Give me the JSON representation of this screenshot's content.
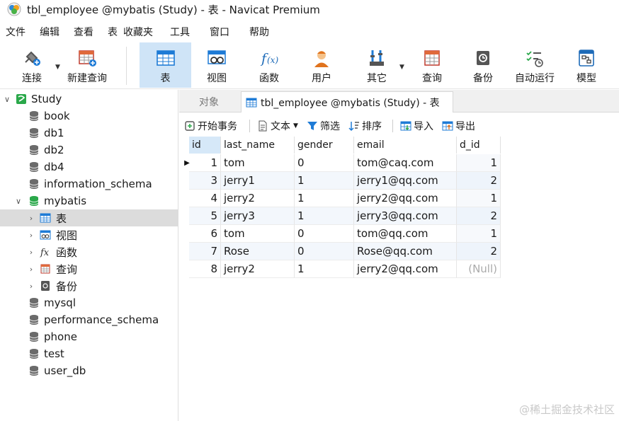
{
  "window": {
    "title": "tbl_employee @mybatis (Study) - 表 - Navicat Premium"
  },
  "menu": [
    "文件",
    "编辑",
    "查看",
    "表",
    "收藏夹",
    "工具",
    "窗口",
    "帮助"
  ],
  "toolbar": {
    "connect": "连接",
    "new_query": "新建查询",
    "table": "表",
    "view": "视图",
    "function": "函数",
    "user": "用户",
    "other": "其它",
    "query": "查询",
    "backup": "备份",
    "autorun": "自动运行",
    "model": "模型"
  },
  "sidebar": {
    "connection": "Study",
    "databases_before": [
      "book",
      "db1",
      "db2",
      "db4",
      "information_schema"
    ],
    "open_db": "mybatis",
    "children": [
      "表",
      "视图",
      "函数",
      "查询",
      "备份"
    ],
    "databases_after": [
      "mysql",
      "performance_schema",
      "phone",
      "test",
      "user_db"
    ]
  },
  "tabs": {
    "objects": "对象",
    "active": "tbl_employee @mybatis (Study) - 表"
  },
  "subtoolbar": {
    "begin_tx": "开始事务",
    "text": "文本",
    "filter": "筛选",
    "sort": "排序",
    "import": "导入",
    "export": "导出"
  },
  "grid": {
    "columns": [
      "id",
      "last_name",
      "gender",
      "email",
      "d_id"
    ],
    "rows": [
      [
        "1",
        "tom",
        "0",
        "tom@caq.com",
        "1"
      ],
      [
        "3",
        "jerry1",
        "1",
        "jerry1@qq.com",
        "2"
      ],
      [
        "4",
        "jerry2",
        "1",
        "jerry2@qq.com",
        "1"
      ],
      [
        "5",
        "jerry3",
        "1",
        "jerry3@qq.com",
        "2"
      ],
      [
        "6",
        "tom",
        "0",
        "tom@qq.com",
        "1"
      ],
      [
        "7",
        "Rose",
        "0",
        "Rose@qq.com",
        "2"
      ],
      [
        "8",
        "jerry2",
        "1",
        "jerry2@qq.com",
        "(Null)"
      ]
    ]
  },
  "watermark": "@稀土掘金技术社区",
  "colors": {
    "accent": "#1e7bd6",
    "selected_bg": "#cfe4f7",
    "db_green": "#2aa84a"
  }
}
